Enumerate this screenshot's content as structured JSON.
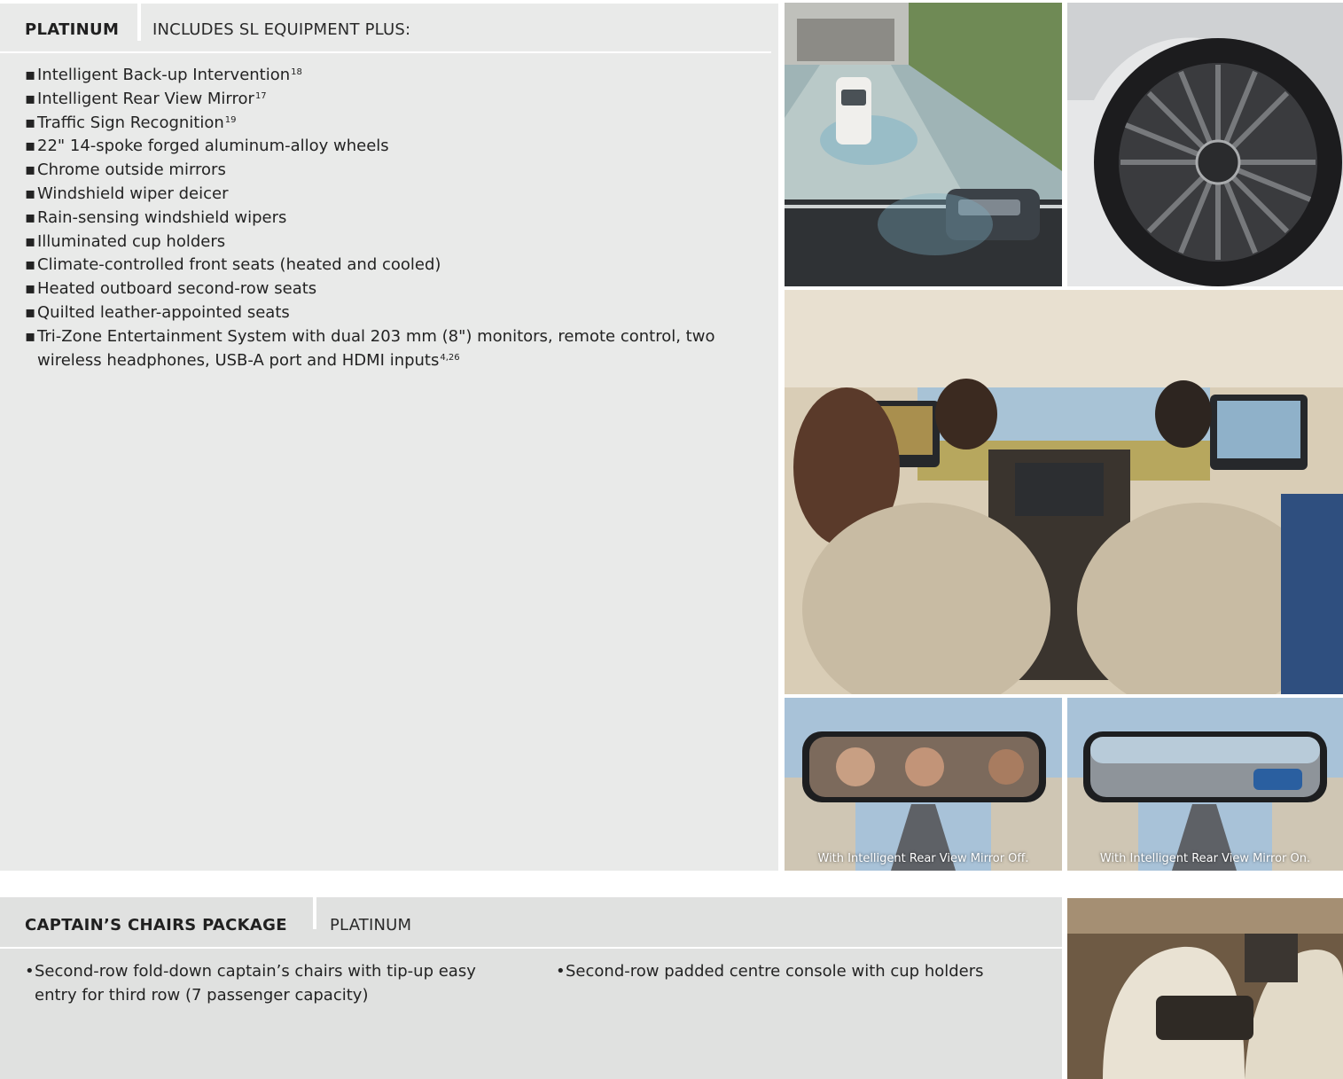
{
  "platinum": {
    "title": "PLATINUM",
    "subtitle": "INCLUDES SL EQUIPMENT PLUS:",
    "features": [
      {
        "text": "Intelligent Back-up Intervention",
        "note": "18"
      },
      {
        "text": "Intelligent Rear View Mirror",
        "note": "17"
      },
      {
        "text": "Traffic Sign Recognition",
        "note": "19"
      },
      {
        "text": "22\" 14-spoke forged aluminum-alloy wheels",
        "note": ""
      },
      {
        "text": "Chrome outside mirrors",
        "note": ""
      },
      {
        "text": "Windshield wiper deicer",
        "note": ""
      },
      {
        "text": "Rain-sensing windshield wipers",
        "note": ""
      },
      {
        "text": "Illuminated cup holders",
        "note": ""
      },
      {
        "text": "Climate-controlled front seats (heated and cooled)",
        "note": ""
      },
      {
        "text": "Heated outboard second-row seats",
        "note": ""
      },
      {
        "text": "Quilted leather-appointed seats",
        "note": ""
      },
      {
        "text": "Tri-Zone Entertainment System with dual 203 mm (8\") monitors, remote control, two wireless headphones, USB-A port and HDMI inputs",
        "note": "4,26"
      }
    ]
  },
  "captain": {
    "title": "CAPTAIN’S CHAIRS PACKAGE",
    "subtitle": "PLATINUM",
    "col1": "Second-row fold-down captain’s chairs with tip-up easy entry for third row (7 passenger capacity)",
    "col2": "Second-row padded centre console with cup holders"
  },
  "bullet_glyph": "▪",
  "captain_bullet_glyph": "•",
  "captions": {
    "mirror_off": "With Intelligent Rear View Mirror Off.",
    "mirror_on": "With Intelligent Rear View Mirror On."
  }
}
